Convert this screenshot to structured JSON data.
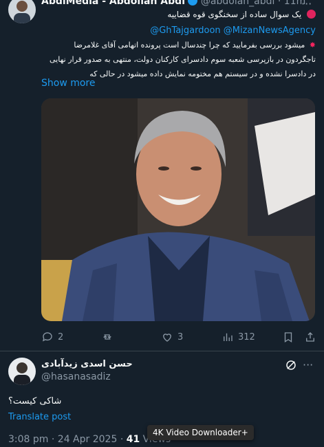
{
  "quoted_tweet": {
    "author_name": "AbdiMedia - Abdollah Abdi",
    "author_handle": "@abdolah_abdi",
    "time": "11m",
    "line1": "یک سوال ساده از سخنگوی قوه قضاییه",
    "mentions": "@GhTajgardoon @MizanNewsAgency",
    "line2": "میشود بررسی بفرمایید که چرا چندسال است پرونده اتهامی آقای غلامرضا",
    "line3": "تاجگردون در بازپرسی شعبه سوم دادسرای کارکنان دولت، منتهی به صدور قرار نهایی",
    "line4": "در دادسرا نشده و در سیستم هم مختومه نمایش داده میشود در حالی که",
    "show_more": "Show more",
    "stats": {
      "replies": "2",
      "likes": "3",
      "views": "312"
    }
  },
  "reply": {
    "author_name": "حسن اسدی زیدآبادی",
    "author_handle": "@hasanasadiz",
    "text": "شاکی کیست؟",
    "translate": "Translate post",
    "time": "3:08 pm",
    "date": "24 Apr 2025",
    "views_count": "41",
    "views_label": "Views"
  },
  "tooltip": "4K Video Downloader+",
  "colors": {
    "background": "#15202b",
    "accent": "#1d9bf0",
    "muted": "#8b98a5"
  }
}
